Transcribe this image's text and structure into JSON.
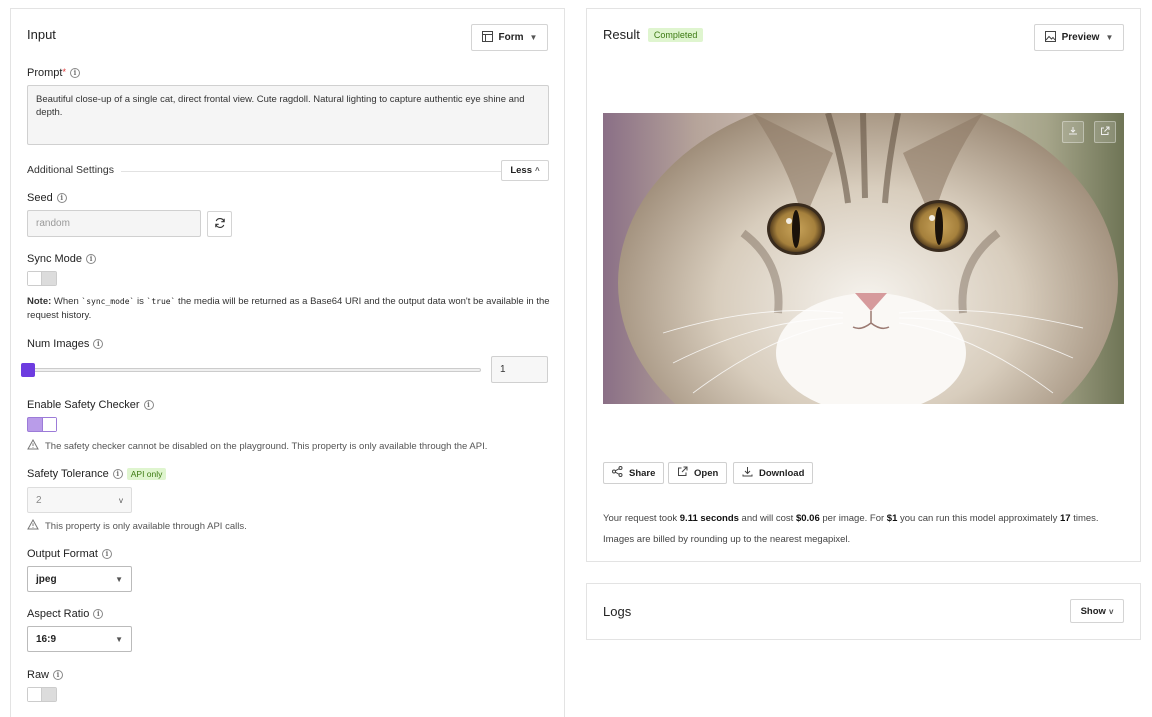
{
  "input": {
    "title": "Input",
    "mode_button": "Form",
    "prompt": {
      "label": "Prompt",
      "required_mark": "*",
      "value": "Beautiful close-up of a single cat, direct frontal view. Cute ragdoll. Natural lighting to capture authentic eye shine and depth."
    },
    "additional_settings": {
      "label": "Additional Settings",
      "toggle_label": "Less"
    },
    "seed": {
      "label": "Seed",
      "placeholder": "random"
    },
    "sync_mode": {
      "label": "Sync Mode",
      "enabled": false,
      "note_prefix": "Note:",
      "note_part1": " When ",
      "note_code1": "`sync_mode`",
      "note_part2": " is ",
      "note_code2": "`true`",
      "note_part3": " the media will be returned as a Base64 URI and the output data won't be available in the request history."
    },
    "num_images": {
      "label": "Num Images",
      "value": "1",
      "slider_fraction": 0.0
    },
    "safety_checker": {
      "label": "Enable Safety Checker",
      "enabled": true,
      "warning": "The safety checker cannot be disabled on the playground. This property is only available through the API."
    },
    "safety_tolerance": {
      "label": "Safety Tolerance",
      "badge": "API only",
      "value": "2",
      "warning": "This property is only available through API calls."
    },
    "output_format": {
      "label": "Output Format",
      "value": "jpeg"
    },
    "aspect_ratio": {
      "label": "Aspect Ratio",
      "value": "16:9"
    },
    "raw": {
      "label": "Raw",
      "enabled": false
    }
  },
  "result": {
    "title": "Result",
    "status": "Completed",
    "view_button": "Preview",
    "actions": {
      "share": "Share",
      "open": "Open",
      "download": "Download"
    },
    "cost": {
      "t1": "Your request took ",
      "seconds": "9.11 seconds",
      "t2": " and will cost ",
      "price": "$0.06",
      "t3": " per image. For ",
      "budget": "$1",
      "t4": " you can run this model approximately ",
      "runs": "17",
      "t5": " times."
    },
    "billing_note": "Images are billed by rounding up to the nearest megapixel."
  },
  "logs": {
    "title": "Logs",
    "toggle_label": "Show"
  },
  "colors": {
    "accent": "#6d3ce0",
    "toggle_on": "#b99ce9",
    "badge_bg": "#dff5cf",
    "badge_fg": "#3c7a12"
  }
}
